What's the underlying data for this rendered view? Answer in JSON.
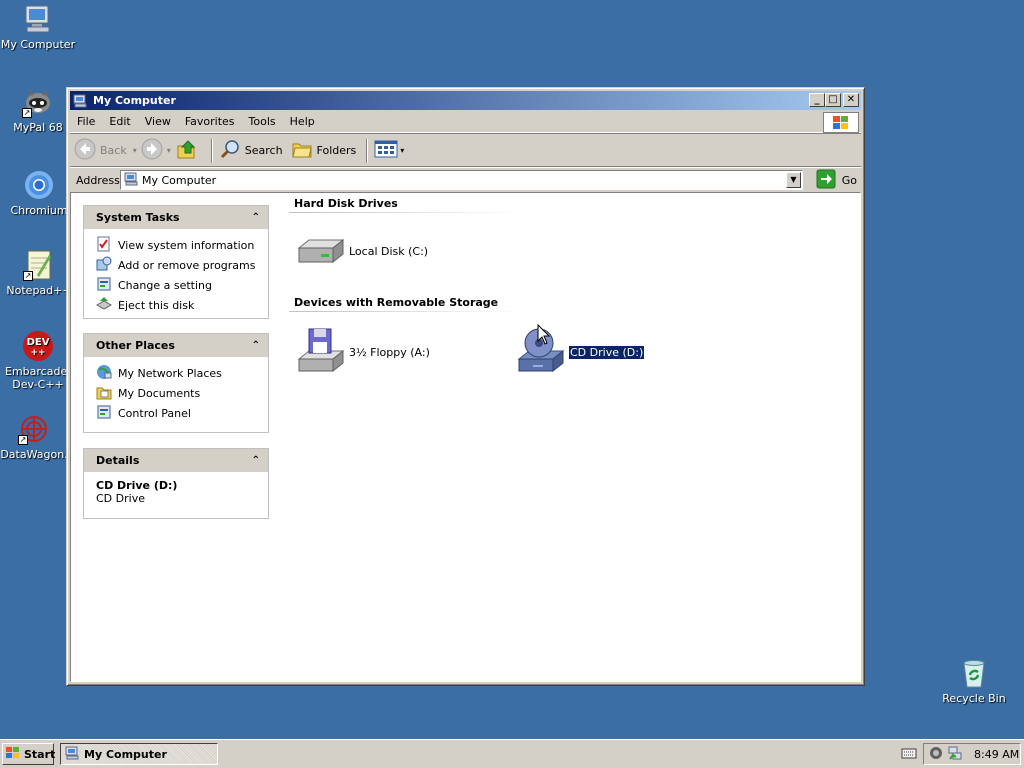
{
  "desktop": {
    "icons": [
      {
        "label": "My Computer"
      },
      {
        "label": "MyPal 68"
      },
      {
        "label": "Chromium"
      },
      {
        "label": "Notepad++"
      },
      {
        "label": "Embarcadero Dev-C++"
      },
      {
        "label": "DataWagon."
      },
      {
        "label": "Recycle Bin"
      }
    ]
  },
  "window": {
    "title": "My Computer",
    "controls": {
      "minimize": "_",
      "maximize": "□",
      "close": "✕"
    },
    "menu": [
      "File",
      "Edit",
      "View",
      "Favorites",
      "Tools",
      "Help"
    ],
    "toolbar": {
      "back": "Back",
      "search": "Search",
      "folders": "Folders"
    },
    "address": {
      "label": "Address",
      "value": "My Computer",
      "go": "Go"
    }
  },
  "left_pane": {
    "system_tasks": {
      "title": "System Tasks",
      "items": [
        "View system information",
        "Add or remove programs",
        "Change a setting",
        "Eject this disk"
      ]
    },
    "other_places": {
      "title": "Other Places",
      "items": [
        "My Network Places",
        "My Documents",
        "Control Panel"
      ]
    },
    "details": {
      "title": "Details",
      "name": "CD Drive (D:)",
      "type": "CD Drive"
    }
  },
  "content": {
    "hard_disk_group": "Hard Disk Drives",
    "removable_group": "Devices with Removable Storage",
    "drives": [
      {
        "label": "Local Disk (C:)"
      },
      {
        "label": "3½ Floppy (A:)"
      },
      {
        "label": "CD Drive (D:)",
        "selected": true
      }
    ]
  },
  "taskbar": {
    "start": "Start",
    "task": "My Computer",
    "clock": "8:49 AM"
  },
  "colors": {
    "desktop": "#3a6ea5",
    "title_gradient_start": "#0a246a",
    "title_gradient_end": "#a6caf0",
    "face": "#d4d0c8",
    "selection": "#0a246a"
  },
  "icons": [
    "computer-icon",
    "raccoon-icon",
    "chromium-icon",
    "notepad-icon",
    "devcpp-icon",
    "datawagon-icon",
    "recycle-bin-icon",
    "back-icon",
    "forward-icon",
    "up-icon",
    "search-icon",
    "folders-icon",
    "views-icon",
    "go-icon",
    "hard-disk-icon",
    "floppy-icon",
    "cd-drive-icon",
    "windows-logo-icon"
  ]
}
